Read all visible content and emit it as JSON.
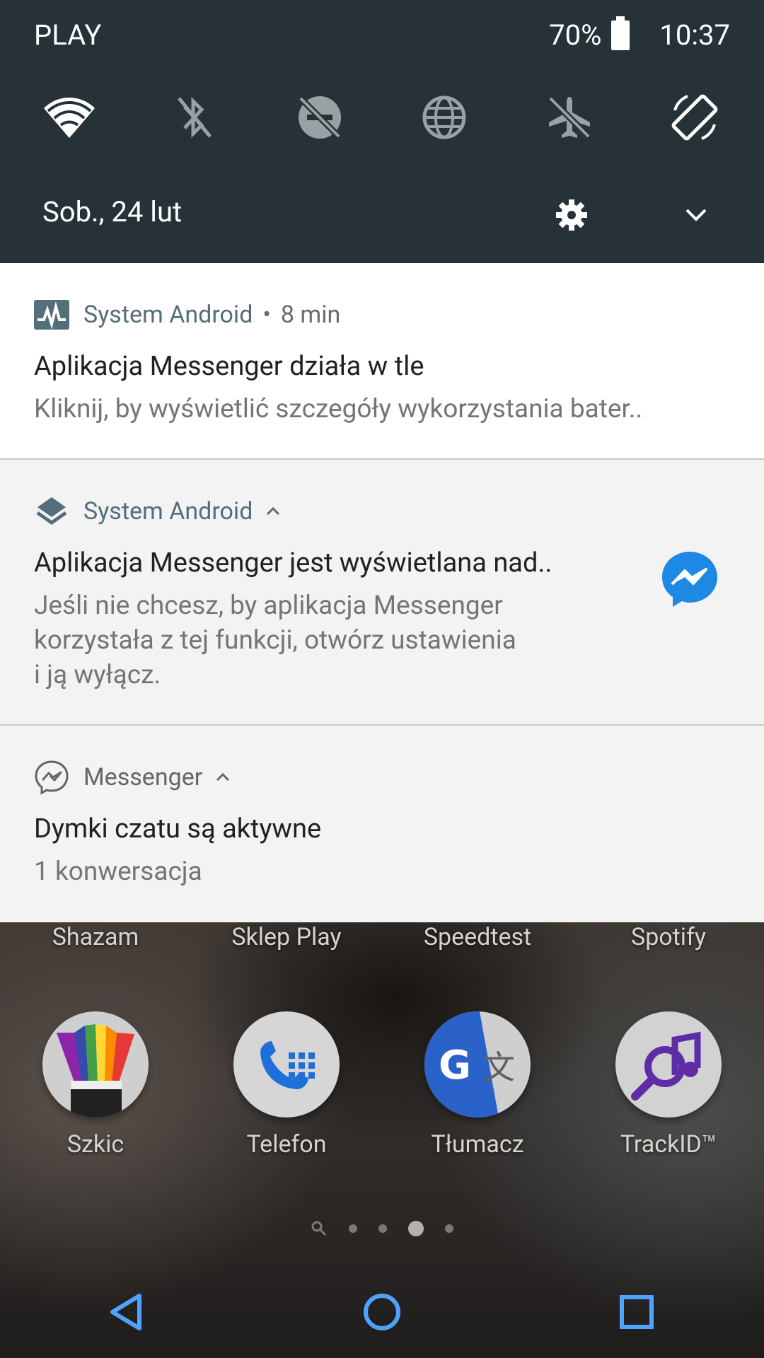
{
  "status_bar": {
    "carrier": "PLAY",
    "battery": "70%",
    "time": "10:37"
  },
  "quick_settings": {
    "tiles": [
      "wifi-icon",
      "bluetooth-off-icon",
      "do-not-disturb-off-icon",
      "globe-icon",
      "airplane-mode-off-icon",
      "auto-rotate-icon"
    ],
    "date": "Sob., 24 lut"
  },
  "notifications": [
    {
      "app": "System Android",
      "time": "8 min",
      "title": "Aplikacja Messenger działa w tle",
      "text": "Kliknij, by wyświetlić szczegóły wykorzystania bater.."
    },
    {
      "app": "System Android",
      "title": "Aplikacja Messenger jest wyświetlana nad..",
      "text_line1": "Jeśli nie chcesz, by aplikacja Messenger",
      "text_line2": "korzystała z tej funkcji, otwórz ustawienia",
      "text_line3": "i ją wyłącz."
    },
    {
      "app": "Messenger",
      "title": "Dymki czatu są aktywne",
      "text": "1 konwersacja"
    }
  ],
  "home": {
    "top_labels": [
      "Shazam",
      "Sklep Play",
      "Speedtest",
      "Spotify"
    ],
    "apps": [
      "Szkic",
      "Telefon",
      "Tłumacz",
      "TrackID™"
    ]
  },
  "colors": {
    "qs_background": "#263238",
    "accent": "#546e7a",
    "messenger_blue": "#1e88e5",
    "nav_glow": "#4fa3ff"
  }
}
